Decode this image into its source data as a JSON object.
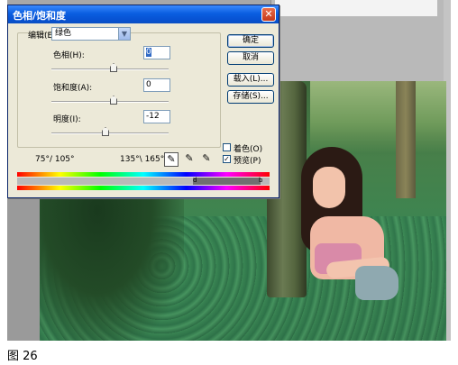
{
  "dialog": {
    "title": "色相/饱和度",
    "close_glyph": "✕",
    "edit_label": "编辑(E):",
    "edit_value": "绿色",
    "hue_label": "色相(H):",
    "hue_value": "0",
    "saturation_label": "饱和度(A):",
    "saturation_value": "0",
    "lightness_label": "明度(I):",
    "lightness_value": "-12",
    "range_left": "75°/ 105°",
    "range_right": "135°\\ 165°",
    "buttons": {
      "ok": "确定",
      "cancel": "取消",
      "load": "载入(L)...",
      "save": "存储(S)..."
    },
    "colorize_label": "着色(O)",
    "colorize_checked": false,
    "preview_label": "预览(P)",
    "preview_checked": true,
    "range_marker_left": "d",
    "range_marker_right": "b"
  },
  "caption": "图 26",
  "icons": [
    "close-icon",
    "dropdown-arrow-icon",
    "eyedropper-icon",
    "eyedropper-plus-icon",
    "eyedropper-minus-icon"
  ]
}
